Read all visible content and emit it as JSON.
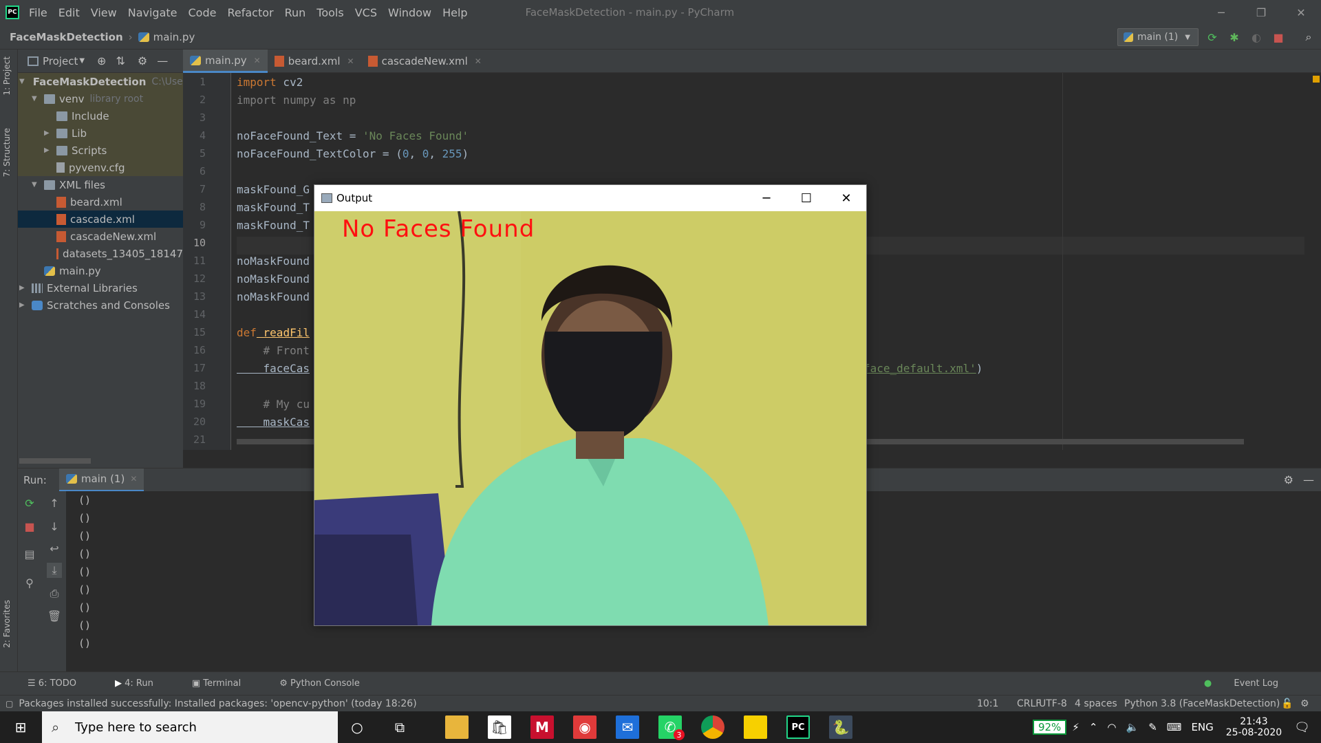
{
  "window": {
    "title": "FaceMaskDetection - main.py - PyCharm"
  },
  "menu": [
    "File",
    "Edit",
    "View",
    "Navigate",
    "Code",
    "Refactor",
    "Run",
    "Tools",
    "VCS",
    "Window",
    "Help"
  ],
  "nav": {
    "project": "FaceMaskDetection",
    "file": "main.py",
    "run_config": "main (1)"
  },
  "left_strip": {
    "project": "1: Project",
    "structure": "7: Structure",
    "favorites": "2: Favorites"
  },
  "project_panel": {
    "header": "Project",
    "tree": [
      {
        "label": "FaceMaskDetection",
        "extra": "C:\\User",
        "icon": "folder-icon"
      },
      {
        "label": "venv",
        "extra": "library root",
        "icon": "folder-icon"
      },
      {
        "label": "Include",
        "extra": "",
        "icon": "folder-icon"
      },
      {
        "label": "Lib",
        "extra": "",
        "icon": "folder-icon"
      },
      {
        "label": "Scripts",
        "extra": "",
        "icon": "folder-icon"
      },
      {
        "label": "pyvenv.cfg",
        "extra": "",
        "icon": "config-file-icon"
      },
      {
        "label": "XML files",
        "extra": "",
        "icon": "folder-icon"
      },
      {
        "label": "beard.xml",
        "extra": "",
        "icon": "xml-file-icon"
      },
      {
        "label": "cascade.xml",
        "extra": "",
        "icon": "xml-file-icon"
      },
      {
        "label": "cascadeNew.xml",
        "extra": "",
        "icon": "xml-file-icon"
      },
      {
        "label": "datasets_13405_18147",
        "extra": "",
        "icon": "xml-file-icon"
      },
      {
        "label": "main.py",
        "extra": "",
        "icon": "python-file-icon"
      },
      {
        "label": "External Libraries",
        "extra": "",
        "icon": "library-icon"
      },
      {
        "label": "Scratches and Consoles",
        "extra": "",
        "icon": "scratches-icon"
      }
    ]
  },
  "editor_tabs": [
    "main.py",
    "beard.xml",
    "cascadeNew.xml"
  ],
  "line_numbers": [
    "1",
    "2",
    "3",
    "4",
    "5",
    "6",
    "7",
    "8",
    "9",
    "10",
    "11",
    "12",
    "13",
    "14",
    "15",
    "16",
    "17",
    "18",
    "19",
    "20",
    "21"
  ],
  "code": {
    "l1a": "import",
    "l1b": " cv2",
    "l2": "import numpy as np",
    "l4a": "noFaceFound_Text = ",
    "l4b": "'No Faces Found'",
    "l5a": "noFaceFound_TextColor = (",
    "l5b": "0",
    "l5c": ", ",
    "l5d": "0",
    "l5e": ", ",
    "l5f": "255",
    "l5g": ")",
    "l7": "maskFound_G",
    "l8": "maskFound_T",
    "l9": "maskFound_T",
    "l11": "noMaskFound",
    "l12": "noMaskFound",
    "l13": "noMaskFound",
    "l15a": "def",
    "l15b": " readFil",
    "l16": "    # Front",
    "l17a": "    faceCas",
    "l17b": "face_default.xml'",
    "l17c": ")",
    "l19": "    # My cu",
    "l20": "    maskCas"
  },
  "run_panel": {
    "label": "Run:",
    "tab": "main (1)",
    "output": [
      "()",
      "()",
      "()",
      "()",
      "()",
      "()",
      "()",
      "()",
      "()"
    ]
  },
  "tool_tabs": {
    "todo": "6: TODO",
    "run": "4: Run",
    "terminal": "Terminal",
    "python_console": "Python Console",
    "event_log": "Event Log"
  },
  "status": {
    "message": "Packages installed successfully: Installed packages: 'opencv-python' (today 18:26)",
    "position": "10:1",
    "line_sep": "CRLF",
    "encoding": "UTF-8",
    "indent": "4 spaces",
    "interpreter": "Python 3.8 (FaceMaskDetection)"
  },
  "output_window": {
    "title": "Output",
    "overlay_text": "No Faces Found"
  },
  "taskbar": {
    "search_placeholder": "Type here to search",
    "battery": "92%",
    "lang": "ENG",
    "time": "21:43",
    "date": "25-08-2020",
    "whatsapp_badge": "3"
  },
  "colors": {
    "accent": "#4a88c7",
    "overlay_text": "#ff1010",
    "battery": "#0a9a3a"
  }
}
